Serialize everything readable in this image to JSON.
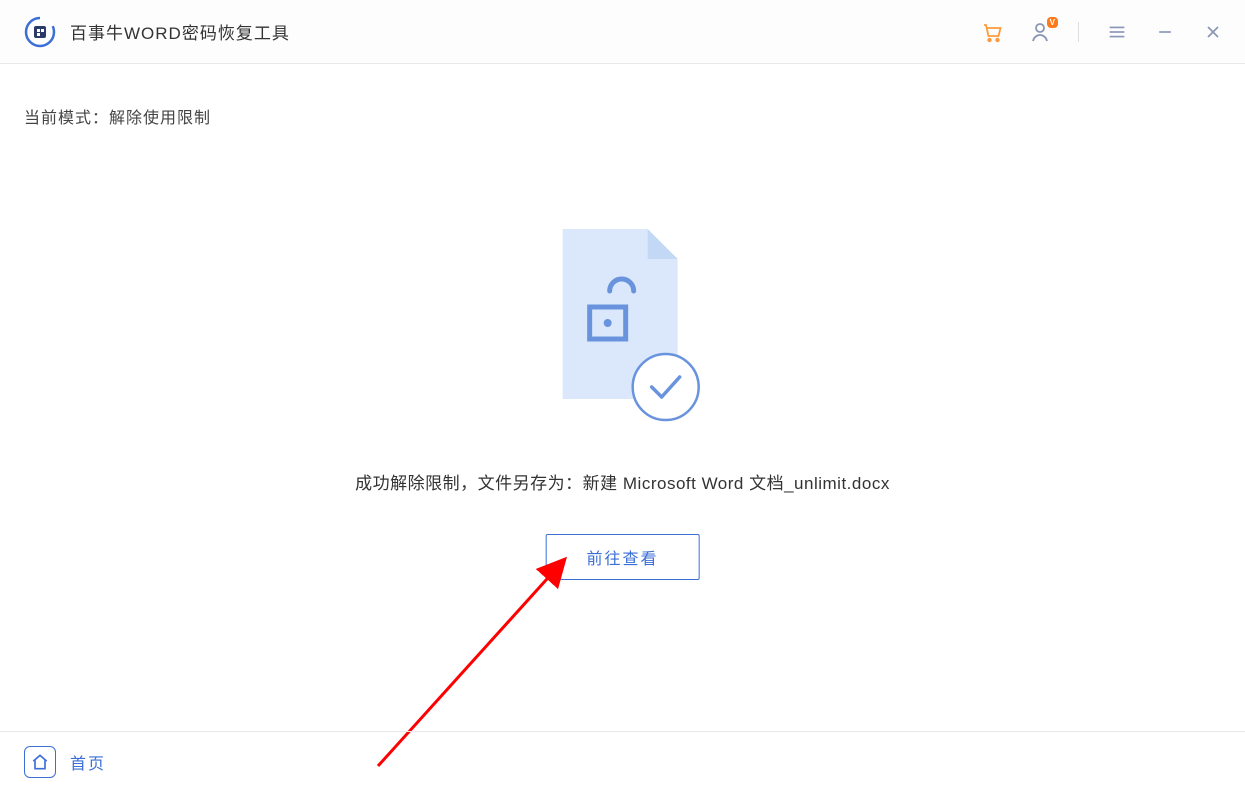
{
  "header": {
    "app_title": "百事牛WORD密码恢复工具"
  },
  "content": {
    "mode_label": "当前模式：解除使用限制",
    "success_message": "成功解除限制，文件另存为：新建 Microsoft Word 文档_unlimit.docx",
    "go_view_button": "前往查看"
  },
  "footer": {
    "home_label": "首页"
  },
  "colors": {
    "accent": "#3b6fd6",
    "cart": "#ff9a3c",
    "arrow": "#ff0000"
  }
}
